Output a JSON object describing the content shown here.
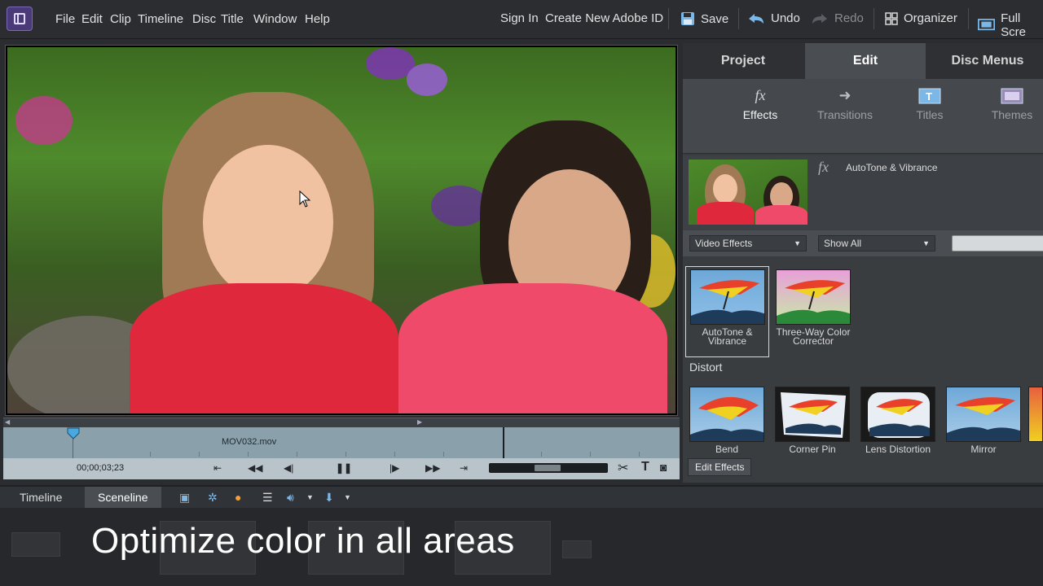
{
  "menubar": {
    "items": [
      "File",
      "Edit",
      "Clip",
      "Timeline",
      "Disc",
      "Title",
      "Window",
      "Help"
    ],
    "sign_in": "Sign In",
    "create_id": "Create New Adobe ID",
    "save": "Save",
    "undo": "Undo",
    "redo": "Redo",
    "organizer": "Organizer",
    "full_screen": "Full Scre"
  },
  "monitor": {
    "clip_name": "MOV032.mov",
    "timecode": "00;00;03;23"
  },
  "panel": {
    "tabs": [
      "Project",
      "Edit",
      "Disc Menus"
    ],
    "subtabs": [
      "Effects",
      "Transitions",
      "Titles",
      "Themes"
    ],
    "selected_effect": "AutoTone & Vibrance",
    "filter_category": "Video Effects",
    "filter_show": "Show All",
    "effects_top": [
      {
        "line1": "AutoTone &",
        "line2": "Vibrance"
      },
      {
        "line1": "Three-Way Color",
        "line2": "Corrector"
      }
    ],
    "category_label": "Distort",
    "effects_distort": [
      "Bend",
      "Corner Pin",
      "Lens Distortion",
      "Mirror"
    ],
    "edit_effects_button": "Edit Effects"
  },
  "bottom": {
    "tabs": [
      "Timeline",
      "Sceneline"
    ],
    "caption": "Optimize color in all areas"
  },
  "colors": {
    "accent": "#7bb8e8",
    "active_tab": "#4a4e53"
  }
}
